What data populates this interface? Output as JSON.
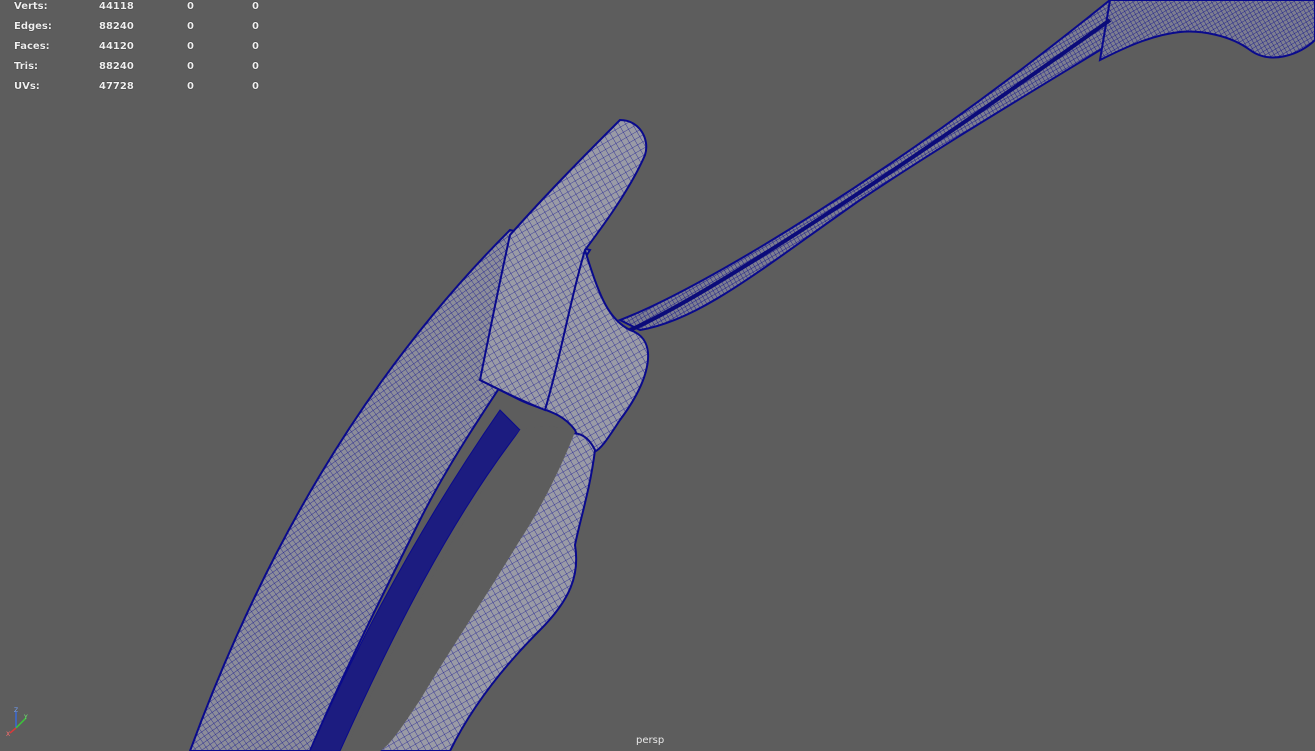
{
  "viewport": {
    "camera_label": "persp",
    "background_color": "#5d5d5d",
    "mesh_wire_color": "#0a0a8c",
    "mesh_shade_color": "#8e8e9a"
  },
  "hud": {
    "rows": [
      {
        "label": "Verts:",
        "values": [
          "44118",
          "0",
          "0"
        ]
      },
      {
        "label": "Edges:",
        "values": [
          "88240",
          "0",
          "0"
        ]
      },
      {
        "label": "Faces:",
        "values": [
          "44120",
          "0",
          "0"
        ]
      },
      {
        "label": "Tris:",
        "values": [
          "88240",
          "0",
          "0"
        ]
      },
      {
        "label": "UVs:",
        "values": [
          "47728",
          "0",
          "0"
        ]
      }
    ]
  },
  "axis_gizmo": {
    "icon": "axis-gizmo-icon",
    "axes": [
      {
        "name": "Z",
        "color": "#3a6ad8"
      },
      {
        "name": "Y",
        "color": "#3ac83a"
      },
      {
        "name": "X",
        "color": "#d83a3a"
      }
    ]
  }
}
